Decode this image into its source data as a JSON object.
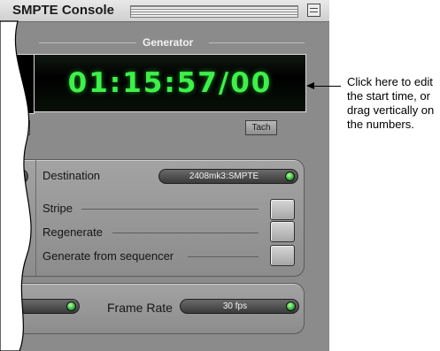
{
  "window": {
    "title": "SMPTE Console"
  },
  "generator": {
    "section_label": "Generator",
    "timecode": "01:15:57/00",
    "left_button_partial": "l",
    "tach_label": "Tach"
  },
  "destination_panel": {
    "destination_label": "Destination",
    "destination_value": "2408mk3:SMPTE",
    "rows": [
      {
        "label": "Stripe"
      },
      {
        "label": "Regenerate"
      },
      {
        "label": "Generate from sequencer"
      }
    ]
  },
  "frame_rate_panel": {
    "label": "Frame Rate",
    "value": "30 fps"
  },
  "callout": {
    "lines": [
      "Click here to edit",
      "the start time, or",
      "drag vertically on",
      "the numbers."
    ]
  },
  "colors": {
    "lcd_green": "#3ef04a",
    "led_green": "#2fb13c",
    "window_gray": "#8b8b8b"
  }
}
